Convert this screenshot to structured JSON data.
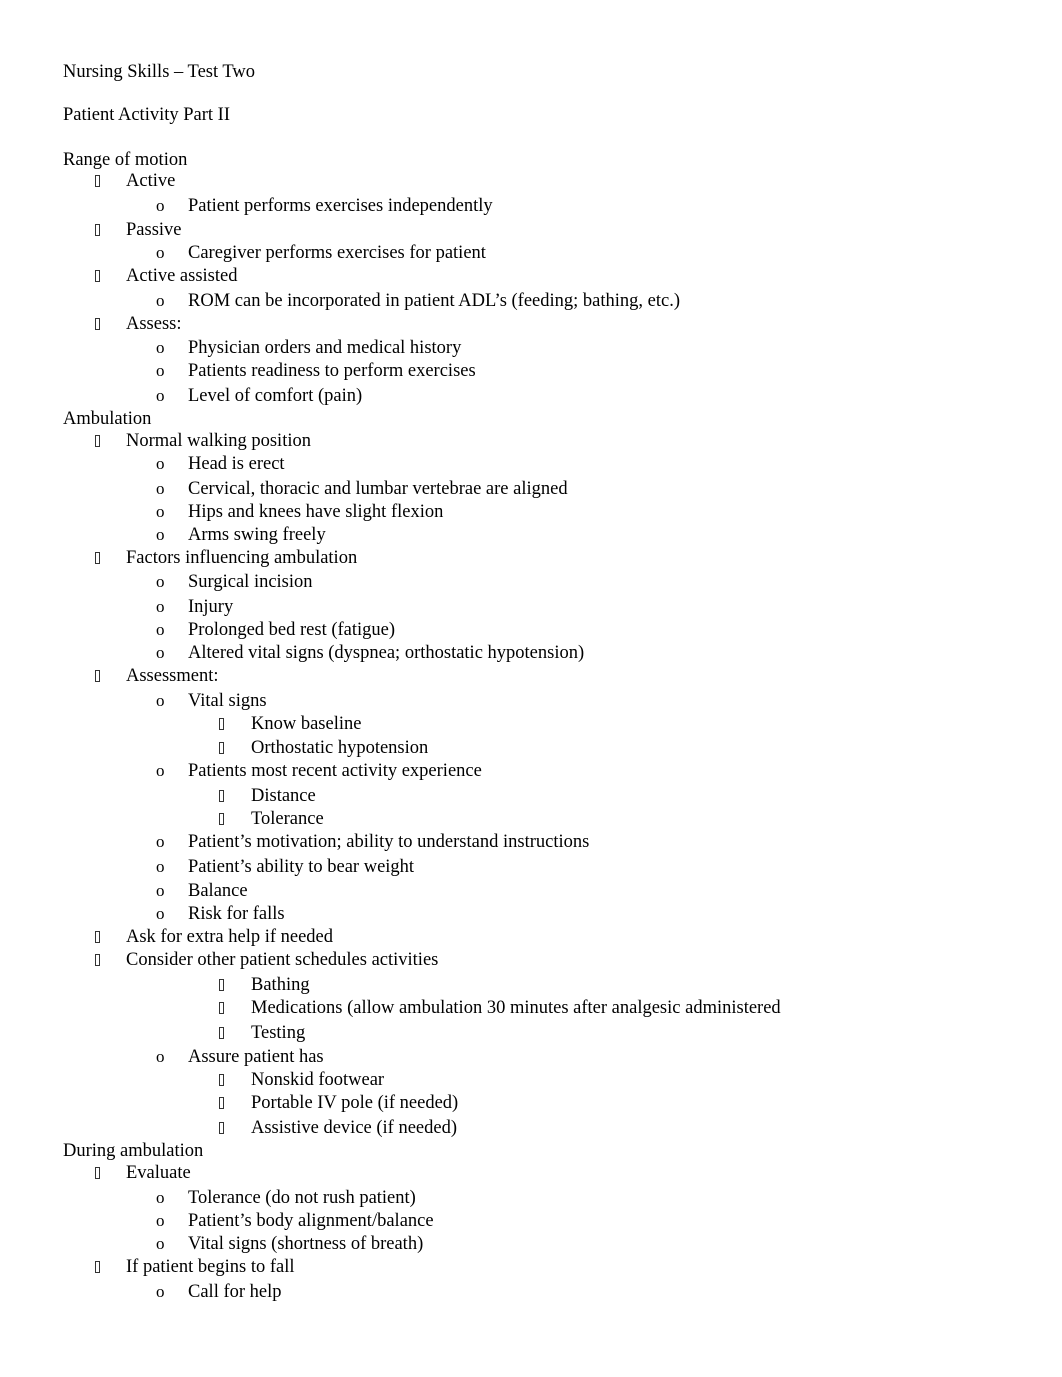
{
  "document": {
    "title": "Nursing Skills – Test Two",
    "subtitle": "Patient Activity Part II",
    "lines": [
      {
        "level": 0,
        "marker": "none",
        "text": "Range of motion"
      },
      {
        "level": 1,
        "marker": "square",
        "text": "Active"
      },
      {
        "level": 2,
        "marker": "o",
        "text": "Patient performs exercises independently"
      },
      {
        "level": 1,
        "marker": "square",
        "text": "Passive"
      },
      {
        "level": 2,
        "marker": "o",
        "text": "Caregiver performs exercises for patient"
      },
      {
        "level": 1,
        "marker": "square",
        "text": "Active assisted"
      },
      {
        "level": 2,
        "marker": "o",
        "text": "ROM can be incorporated in patient ADL’s (feeding; bathing, etc.)"
      },
      {
        "level": 1,
        "marker": "square",
        "text": "Assess:"
      },
      {
        "level": 2,
        "marker": "o",
        "text": "Physician orders and medical history"
      },
      {
        "level": 2,
        "marker": "o",
        "text": "Patients readiness to perform exercises"
      },
      {
        "level": 2,
        "marker": "o",
        "text": "Level of comfort (pain)"
      },
      {
        "level": 0,
        "marker": "none",
        "text": "Ambulation"
      },
      {
        "level": 1,
        "marker": "square",
        "text": "Normal walking position"
      },
      {
        "level": 2,
        "marker": "o",
        "text": "Head is erect"
      },
      {
        "level": 2,
        "marker": "o",
        "text": "Cervical, thoracic and lumbar vertebrae are aligned"
      },
      {
        "level": 2,
        "marker": "o",
        "text": "Hips and knees have slight flexion"
      },
      {
        "level": 2,
        "marker": "o",
        "text": "Arms swing freely"
      },
      {
        "level": 1,
        "marker": "square",
        "text": "Factors influencing ambulation"
      },
      {
        "level": 2,
        "marker": "o",
        "text": "Surgical incision"
      },
      {
        "level": 2,
        "marker": "o",
        "text": "Injury"
      },
      {
        "level": 2,
        "marker": "o",
        "text": "Prolonged bed rest (fatigue)"
      },
      {
        "level": 2,
        "marker": "o",
        "text": "Altered vital signs (dyspnea; orthostatic hypotension)"
      },
      {
        "level": 1,
        "marker": "square",
        "text": "Assessment:"
      },
      {
        "level": 2,
        "marker": "o",
        "text": "Vital signs"
      },
      {
        "level": 3,
        "marker": "square",
        "text": "Know baseline"
      },
      {
        "level": 3,
        "marker": "square",
        "text": "Orthostatic hypotension"
      },
      {
        "level": 2,
        "marker": "o",
        "text": "Patients most recent activity experience"
      },
      {
        "level": 3,
        "marker": "square",
        "text": "Distance"
      },
      {
        "level": 3,
        "marker": "square",
        "text": "Tolerance"
      },
      {
        "level": 2,
        "marker": "o",
        "text": "Patient’s motivation; ability to understand instructions"
      },
      {
        "level": 2,
        "marker": "o",
        "text": "Patient’s ability to bear weight"
      },
      {
        "level": 2,
        "marker": "o",
        "text": "Balance"
      },
      {
        "level": 2,
        "marker": "o",
        "text": "Risk for falls"
      },
      {
        "level": 1,
        "marker": "square",
        "text": "Ask for extra help if needed"
      },
      {
        "level": 1,
        "marker": "square",
        "text": "Consider other patient schedules activities"
      },
      {
        "level": 3,
        "marker": "square",
        "text": "Bathing"
      },
      {
        "level": 3,
        "marker": "square",
        "text": "Medications (allow ambulation 30 minutes after analgesic administered"
      },
      {
        "level": 3,
        "marker": "square",
        "text": "Testing"
      },
      {
        "level": 2,
        "marker": "o",
        "text": "Assure patient has"
      },
      {
        "level": 3,
        "marker": "square",
        "text": "Nonskid footwear"
      },
      {
        "level": 3,
        "marker": "square",
        "text": "Portable IV pole (if needed)"
      },
      {
        "level": 3,
        "marker": "square",
        "text": "Assistive device (if needed)"
      },
      {
        "level": 0,
        "marker": "none",
        "text": "During ambulation"
      },
      {
        "level": 1,
        "marker": "square",
        "text": "Evaluate"
      },
      {
        "level": 2,
        "marker": "o",
        "text": "Tolerance (do not rush patient)"
      },
      {
        "level": 2,
        "marker": "o",
        "text": "Patient’s body alignment/balance"
      },
      {
        "level": 2,
        "marker": "o",
        "text": "Vital signs (shortness of breath)"
      },
      {
        "level": 1,
        "marker": "square",
        "text": "If patient begins to fall"
      },
      {
        "level": 2,
        "marker": "o",
        "text": "Call for help"
      }
    ]
  }
}
